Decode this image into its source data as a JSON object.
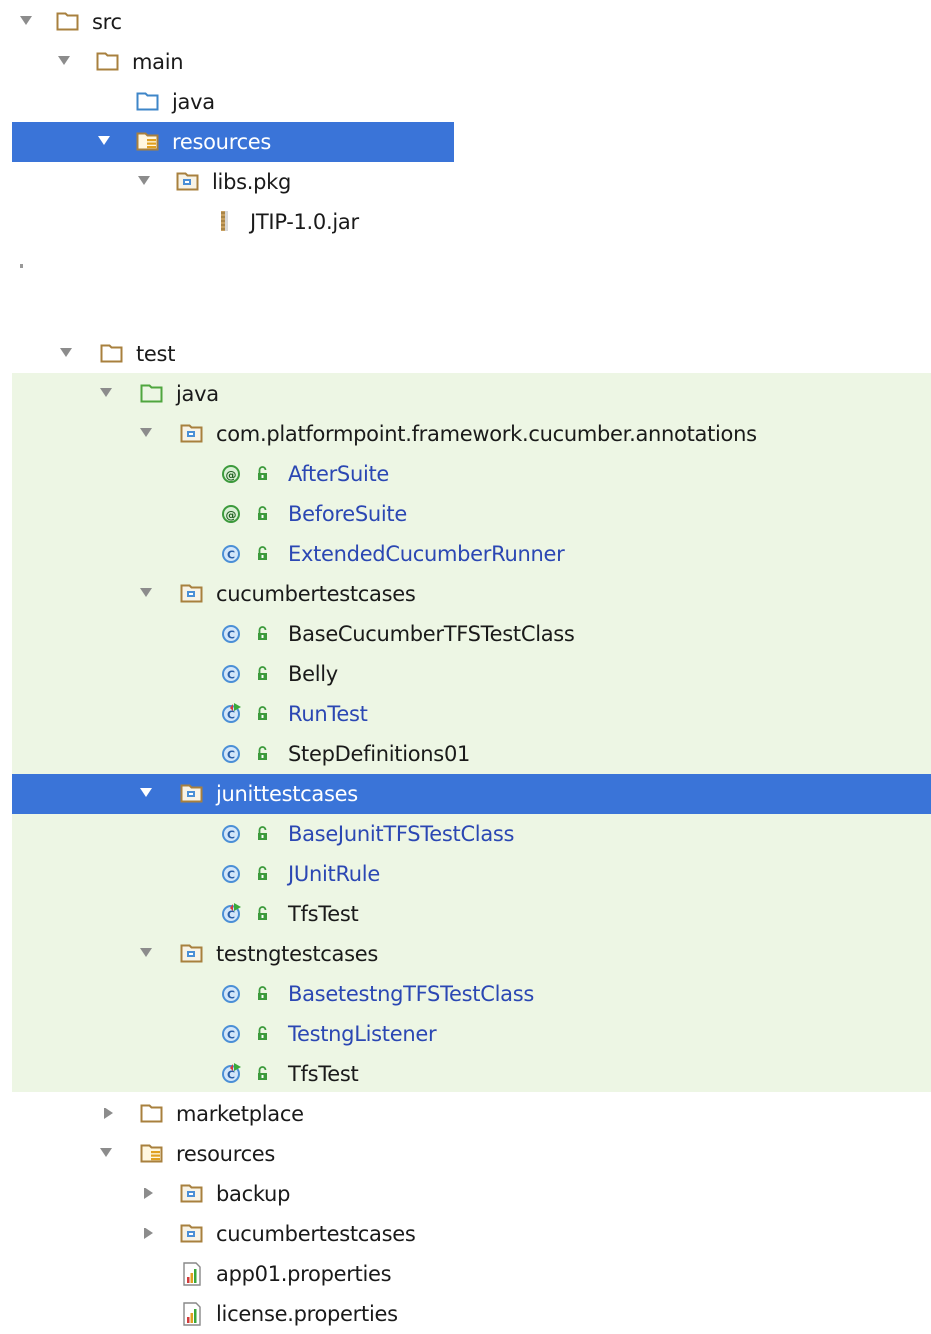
{
  "colors": {
    "selection": "#3a74d8",
    "test_source_band": "#edf6e4",
    "folder_outline": "#a8803e",
    "source_folder": "#3e86c8",
    "test_folder": "#4fa63e",
    "class_icon": "#4b8fd6",
    "annotation_icon": "#3c9a3c",
    "blue_text": "#2b47b3"
  },
  "tree": {
    "src": {
      "label": "src",
      "icon": "folder-icon"
    },
    "main": {
      "label": "main",
      "icon": "folder-icon"
    },
    "main_java": {
      "label": "java",
      "icon": "source-folder-icon"
    },
    "main_resources": {
      "label": "resources",
      "icon": "resources-folder-icon"
    },
    "libs_pkg": {
      "label": "libs.pkg",
      "icon": "package-icon"
    },
    "jtip_jar": {
      "label": "JTIP-1.0.jar",
      "icon": "jar-icon"
    },
    "test": {
      "label": "test",
      "icon": "folder-icon"
    },
    "test_java": {
      "label": "java",
      "icon": "test-source-folder-icon"
    },
    "pkg_annotations": {
      "label": "com.platformpoint.framework.cucumber.annotations",
      "icon": "package-icon"
    },
    "after_suite": {
      "label": "AfterSuite",
      "icon": "annotation-icon"
    },
    "before_suite": {
      "label": "BeforeSuite",
      "icon": "annotation-icon"
    },
    "extended_runner": {
      "label": "ExtendedCucumberRunner",
      "icon": "class-icon"
    },
    "pkg_cucumber": {
      "label": "cucumbertestcases",
      "icon": "package-icon"
    },
    "base_cucumber": {
      "label": "BaseCucumberTFSTestClass",
      "icon": "class-icon"
    },
    "belly": {
      "label": "Belly",
      "icon": "class-icon"
    },
    "run_test": {
      "label": "RunTest",
      "icon": "test-class-icon"
    },
    "step_defs": {
      "label": "StepDefinitions01",
      "icon": "class-icon"
    },
    "pkg_junit": {
      "label": "junittestcases",
      "icon": "package-icon"
    },
    "base_junit": {
      "label": "BaseJunitTFSTestClass",
      "icon": "class-icon"
    },
    "junit_rule": {
      "label": "JUnitRule",
      "icon": "class-icon"
    },
    "tfs_test_junit": {
      "label": "TfsTest",
      "icon": "test-class-icon"
    },
    "pkg_testng": {
      "label": "testngtestcases",
      "icon": "package-icon"
    },
    "base_testng": {
      "label": "BasetestngTFSTestClass",
      "icon": "class-icon"
    },
    "testng_listener": {
      "label": "TestngListener",
      "icon": "class-icon"
    },
    "tfs_test_testng": {
      "label": "TfsTest",
      "icon": "test-class-icon"
    },
    "marketplace": {
      "label": "marketplace",
      "icon": "folder-icon"
    },
    "test_resources": {
      "label": "resources",
      "icon": "resources-folder-icon"
    },
    "backup": {
      "label": "backup",
      "icon": "package-icon"
    },
    "res_cucumber": {
      "label": "cucumbertestcases",
      "icon": "package-icon"
    },
    "app_props": {
      "label": "app01.properties",
      "icon": "properties-file-icon"
    },
    "license_props": {
      "label": "license.properties",
      "icon": "properties-file-icon"
    }
  }
}
